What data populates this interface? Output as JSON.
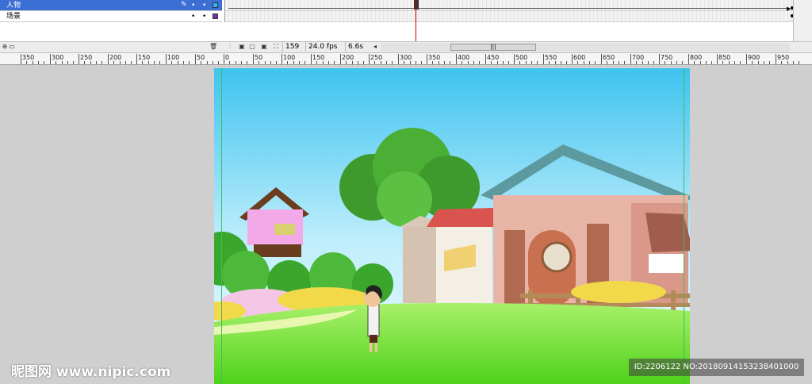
{
  "timeline": {
    "layers": [
      {
        "name": "人物",
        "selected": true,
        "swatch_color": "#2fb3ff"
      },
      {
        "name": "场景",
        "selected": false,
        "swatch_color": "#7a2fb0"
      }
    ],
    "eye_dot": "•",
    "lock_dot": "•"
  },
  "statusbar": {
    "current_frame": "159",
    "frame_rate": "24.0 fps",
    "elapsed_time": "6.6s",
    "scroll_left_arrow": "◂",
    "scroll_grip": "|||"
  },
  "ruler": {
    "labels": [
      "350",
      "300",
      "250",
      "200",
      "150",
      "100",
      "50",
      "0",
      "50",
      "100",
      "150",
      "200",
      "250",
      "300",
      "350",
      "400",
      "450",
      "500",
      "550",
      "600",
      "650",
      "700",
      "750",
      "800",
      "850",
      "900",
      "950"
    ]
  },
  "watermark": {
    "logo": "昵图网 www.nipic.com",
    "id_text": "ID:2206122 NO:20180914153238401000"
  },
  "colors": {
    "timeline_selected": "#3b6fd6",
    "playhead": "#cc0000",
    "guide": "#3bbf5a",
    "sky_top": "#3fc3f0",
    "grass": "#6fe02a"
  }
}
